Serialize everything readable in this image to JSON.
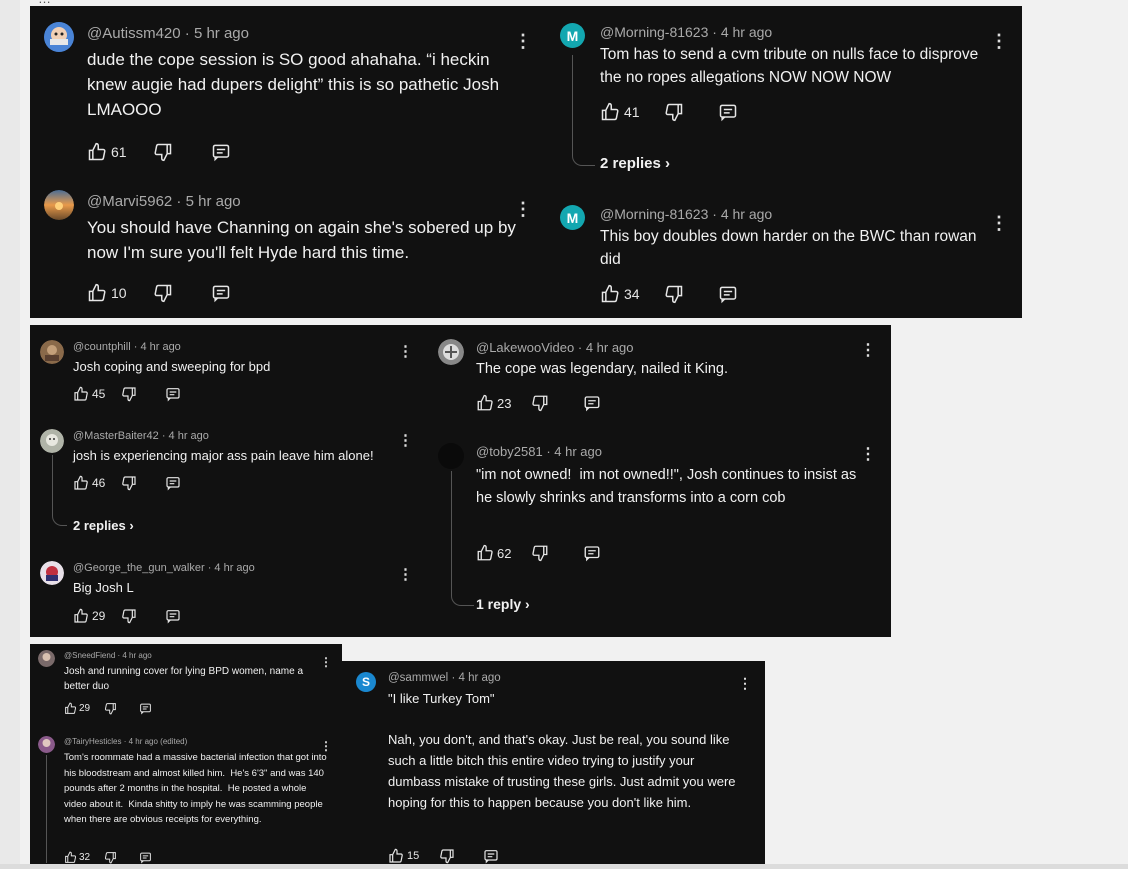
{
  "page": {
    "partial_top_text": "…"
  },
  "icons": {
    "like": "thumbs-up-icon",
    "dislike": "thumbs-down-icon",
    "reply": "reply-comment-icon",
    "more": "more-vertical-icon",
    "chevron": "chevron-right-icon"
  },
  "colors": {
    "panel_bg": "#111111",
    "meta_text": "#aaaaaa",
    "body_text": "#f1f1f1",
    "teal_avatar": "#13a7b0",
    "blue_avatar": "#1a88d0"
  },
  "panel1": {
    "c1": {
      "author": "@Autissm420",
      "time": "5 hr ago",
      "text": "dude the cope session is SO good ahahaha. “i heckin knew augie had dupers delight” this is so pathetic Josh LMAOOO",
      "likes": "61"
    },
    "c2": {
      "author": "@Marvi5962",
      "time": "5 hr ago",
      "text": "You should have Channing on again she's sobered up by now I'm sure you'll felt Hyde hard this time.",
      "likes": "10"
    },
    "c3": {
      "avatar_letter": "M",
      "author": "@Morning-81623",
      "time": "4 hr ago",
      "text": "Tom has to send a cvm tribute on nulls face to disprove the no ropes allegations NOW NOW NOW",
      "likes": "41",
      "replies": "2 replies"
    },
    "c4": {
      "avatar_letter": "M",
      "author": "@Morning-81623",
      "time": "4 hr ago",
      "text": "This boy doubles down harder on the BWC than rowan did",
      "likes": "34"
    }
  },
  "panel2": {
    "c1": {
      "author": "@countphill",
      "time": "4 hr ago",
      "text": "Josh coping and sweeping for bpd",
      "likes": "45"
    },
    "c2": {
      "author": "@MasterBaiter42",
      "time": "4 hr ago",
      "text": "josh is experiencing major ass pain leave him alone!",
      "likes": "46",
      "replies": "2 replies"
    },
    "c3": {
      "author": "@George_the_gun_walker",
      "time": "4 hr ago",
      "text": "Big Josh L",
      "likes": "29"
    },
    "c4": {
      "author": "@LakewooVideo",
      "time": "4 hr ago",
      "text": "The cope was legendary, nailed it King.",
      "likes": "23"
    },
    "c5": {
      "author": "@toby2581",
      "time": "4 hr ago",
      "text": "\"im not owned!  im not owned!!\", Josh continues to insist as he slowly shrinks and transforms into a corn cob",
      "likes": "62",
      "replies": "1 reply"
    }
  },
  "panel3": {
    "c1": {
      "author": "@SneedFiend",
      "time": "4 hr ago",
      "text": "Josh and running cover for lying BPD women, name a better duo",
      "likes": "29"
    },
    "c2": {
      "author": "@TairyHesticles",
      "time": "4 hr ago (edited)",
      "text": "Tom's roommate had a massive bacterial infection that got into his bloodstream and almost killed him.  He's 6'3\" and was 140 pounds after 2 months in the hospital.  He posted a whole video about it.  Kinda shitty to imply he was scamming people when there are obvious receipts for everything.",
      "likes": "32"
    }
  },
  "panel4": {
    "c1": {
      "avatar_letter": "S",
      "author": "@sammwel",
      "time": "4 hr ago",
      "text": "\"I like Turkey Tom\"\n\nNah, you don't, and that's okay. Just be real, you sound like such a little bitch this entire video trying to justify your dumbass mistake of trusting these girls. Just admit you were hoping for this to happen because you don't like him.",
      "likes": "15"
    }
  }
}
